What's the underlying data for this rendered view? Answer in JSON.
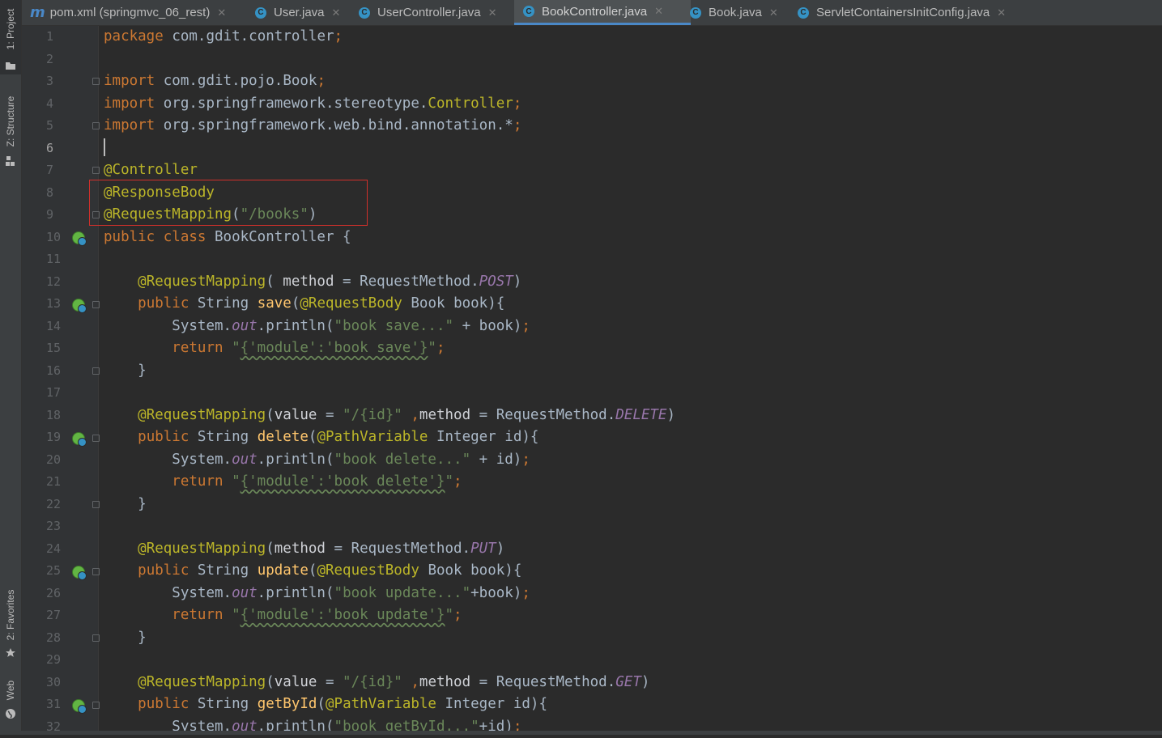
{
  "tool_windows": {
    "project": "1: Project",
    "structure": "Z: Structure",
    "favorites": "2: Favorites",
    "web": "Web"
  },
  "tabs": [
    {
      "label": "pom.xml (springmvc_06_rest)",
      "icon": "maven-icon",
      "active": false
    },
    {
      "label": "User.java",
      "icon": "class-icon",
      "active": false
    },
    {
      "label": "UserController.java",
      "icon": "class-icon",
      "active": false
    },
    {
      "label": "BookController.java",
      "icon": "class-icon",
      "active": true
    },
    {
      "label": "Book.java",
      "icon": "class-icon",
      "active": false
    },
    {
      "label": "ServletContainersInitConfig.java",
      "icon": "class-icon",
      "active": false
    }
  ],
  "editor": {
    "current_line": 6,
    "line_numbers": [
      "1",
      "2",
      "3",
      "4",
      "5",
      "6",
      "7",
      "8",
      "9",
      "10",
      "11",
      "12",
      "13",
      "14",
      "15",
      "16",
      "17",
      "18",
      "19",
      "20",
      "21",
      "22",
      "23",
      "24",
      "25",
      "26",
      "27",
      "28",
      "29",
      "30",
      "31",
      "32"
    ],
    "highlight_color": "#d0302b",
    "lines": [
      "package com.gdit.controller;",
      "",
      "import com.gdit.pojo.Book;",
      "import org.springframework.stereotype.Controller;",
      "import org.springframework.web.bind.annotation.*;",
      "",
      "@Controller",
      "@ResponseBody",
      "@RequestMapping(\"/books\")",
      "public class BookController {",
      "",
      "    @RequestMapping( method = RequestMethod.POST)",
      "    public String save(@RequestBody Book book){",
      "        System.out.println(\"book save...\" + book);",
      "        return \"{'module':'book save'}\";",
      "    }",
      "",
      "    @RequestMapping(value = \"/{id}\" ,method = RequestMethod.DELETE)",
      "    public String delete(@PathVariable Integer id){",
      "        System.out.println(\"book delete...\" + id);",
      "        return \"{'module':'book delete'}\";",
      "    }",
      "",
      "    @RequestMapping(method = RequestMethod.PUT)",
      "    public String update(@RequestBody Book book){",
      "        System.out.println(\"book update...\"+book);",
      "        return \"{'module':'book update'}\";",
      "    }",
      "",
      "    @RequestMapping(value = \"/{id}\" ,method = RequestMethod.GET)",
      "    public String getById(@PathVariable Integer id){",
      "        System.out.println(\"book getById...\"+id);"
    ]
  }
}
